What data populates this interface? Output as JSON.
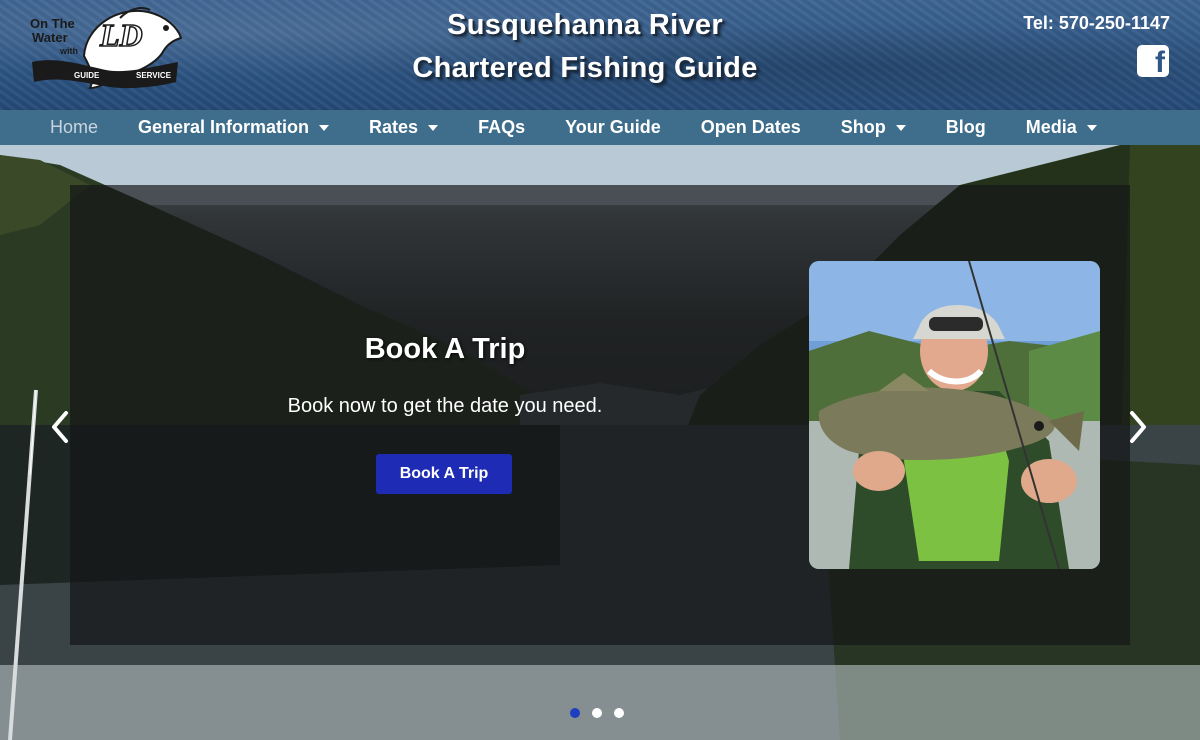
{
  "header": {
    "logo_text": {
      "line1": "On The",
      "line2": "Water",
      "line3": "with",
      "initials": "LD",
      "guide": "GUIDE",
      "service": "SERVICE"
    },
    "title_line1": "Susquehanna River",
    "title_line2": "Chartered Fishing Guide",
    "phone": "Tel: 570-250-1147",
    "facebook_glyph": "f"
  },
  "nav": {
    "items": [
      {
        "label": "Home",
        "dropdown": false
      },
      {
        "label": "General Information",
        "dropdown": true
      },
      {
        "label": "Rates",
        "dropdown": true
      },
      {
        "label": "FAQs",
        "dropdown": false
      },
      {
        "label": "Your Guide",
        "dropdown": false
      },
      {
        "label": "Open Dates",
        "dropdown": false
      },
      {
        "label": "Shop",
        "dropdown": true
      },
      {
        "label": "Blog",
        "dropdown": false
      },
      {
        "label": "Media",
        "dropdown": true
      }
    ]
  },
  "slider": {
    "title": "Book A Trip",
    "subtitle": "Book now to get the date you need.",
    "button_label": "Book A Trip",
    "prev_icon": "chevron-left-icon",
    "next_icon": "chevron-right-icon",
    "dot_count": 3,
    "active_dot": 1
  },
  "colors": {
    "header_blue": "#2f5786",
    "nav_bg": "#3f6e8c",
    "button_blue": "#1d2bb5",
    "active_dot": "#1d3fc0"
  }
}
